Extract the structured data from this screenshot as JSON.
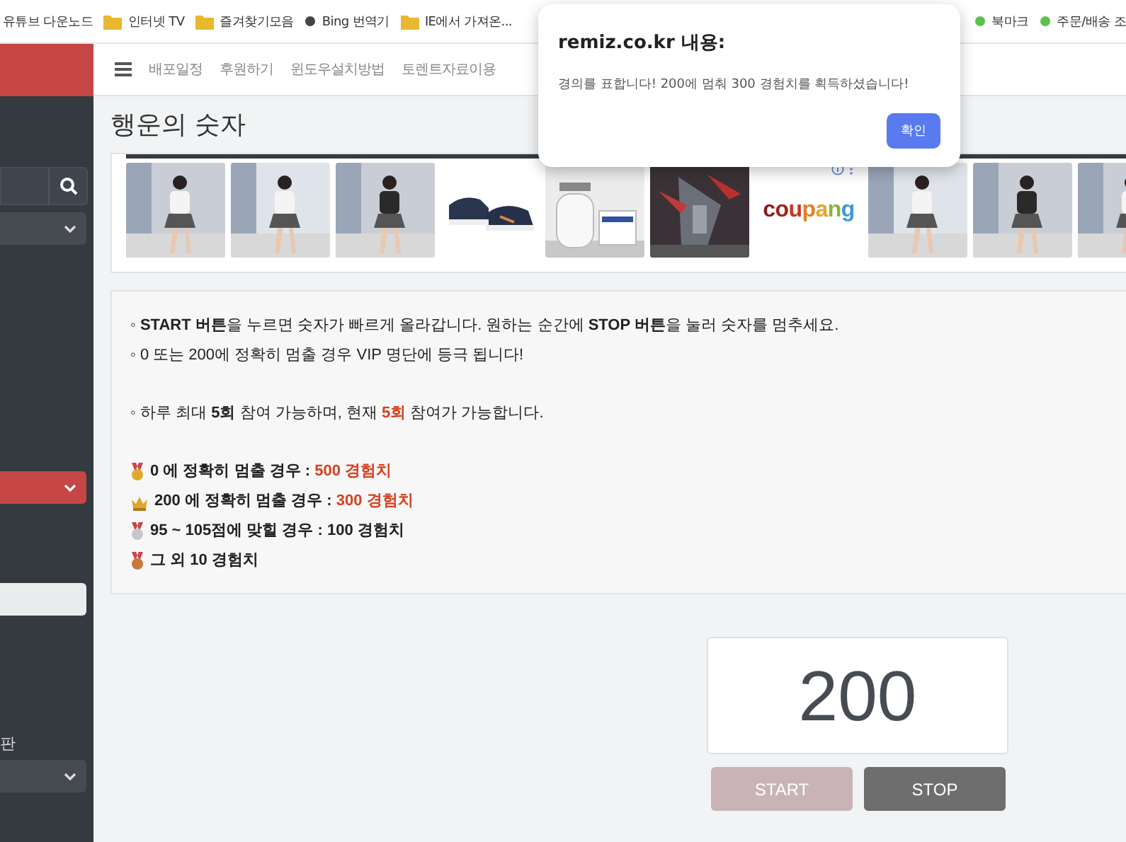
{
  "bookmarks": [
    {
      "label": "유튜브 다운노드",
      "kind": "plain"
    },
    {
      "label": "인터넷 TV",
      "kind": "folder"
    },
    {
      "label": "즐겨찾기모음",
      "kind": "folder"
    },
    {
      "label": "Bing 번역기",
      "kind": "site"
    },
    {
      "label": "IE에서 가져온...",
      "kind": "folder"
    },
    {
      "label": "북마크",
      "kind": "site"
    },
    {
      "label": "주문/배송 조",
      "kind": "site"
    }
  ],
  "nav": {
    "items": [
      "배포일정",
      "후원하기",
      "윈도우설치방법",
      "토렌트자료이용"
    ]
  },
  "page_title": "행운의 숫자",
  "ads": {
    "items": [
      {
        "kind": "picture"
      },
      {
        "kind": "picture"
      },
      {
        "kind": "picture"
      },
      {
        "kind": "picture"
      },
      {
        "kind": "picture"
      },
      {
        "kind": "picture"
      },
      {
        "kind": "logo",
        "text": "coupang"
      },
      {
        "kind": "picture"
      },
      {
        "kind": "picture"
      },
      {
        "kind": "picture"
      }
    ]
  },
  "info": {
    "lines": [
      {
        "parts": [
          {
            "text": "◦ ",
            "kind": "plain"
          },
          {
            "text": "START 버튼",
            "kind": "bold"
          },
          {
            "text": "을 누르면 숫자가 빠르게 올라갑니다. 원하는 순간에 ",
            "kind": "plain"
          },
          {
            "text": "STOP 버튼",
            "kind": "bold"
          },
          {
            "text": "을 눌러 숫자를 멈추세요.",
            "kind": "plain"
          }
        ]
      },
      {
        "parts": [
          {
            "text": "◦ 0 또는 200에 정확히 멈출 경우 VIP 명단에 등극 됩니다!",
            "kind": "plain"
          }
        ]
      },
      {
        "parts": [
          {
            "text": "◦ 하루 최대 ",
            "kind": "plain"
          },
          {
            "text": "5회",
            "kind": "bold"
          },
          {
            "text": " 참여 가능하며, 현재 ",
            "kind": "plain"
          },
          {
            "text": "5회",
            "kind": "highlight"
          },
          {
            "text": " 참여가 가능합니다.",
            "kind": "plain"
          }
        ]
      }
    ],
    "rewards": [
      {
        "kind": "gold",
        "parts": [
          {
            "text": "0 에 정확히 멈출 경우 : ",
            "kind": "bold"
          },
          {
            "text": "500 경험치",
            "kind": "highlight"
          }
        ]
      },
      {
        "kind": "crown",
        "parts": [
          {
            "text": "200 에 정확히 멈출 경우 : ",
            "kind": "bold"
          },
          {
            "text": "300 경험치",
            "kind": "highlight"
          }
        ]
      },
      {
        "kind": "silver",
        "parts": [
          {
            "text": "95 ~ 105점에 맞힐 경우 : 100 경험치",
            "kind": "bold"
          }
        ]
      },
      {
        "kind": "bronze",
        "parts": [
          {
            "text": "그 외 10 경험치",
            "kind": "bold"
          }
        ]
      }
    ]
  },
  "sidebar": {
    "caption": "판"
  },
  "counter": {
    "value": "200"
  },
  "buttons": [
    {
      "label": "START",
      "disabled": true
    },
    {
      "label": "STOP",
      "disabled": false
    }
  ],
  "dialog": {
    "title": "remiz.co.kr 내용:",
    "message": "경의를 표합니다! 200에 멈춰 300 경험치를 획득하셨습니다!",
    "button": "확인"
  }
}
